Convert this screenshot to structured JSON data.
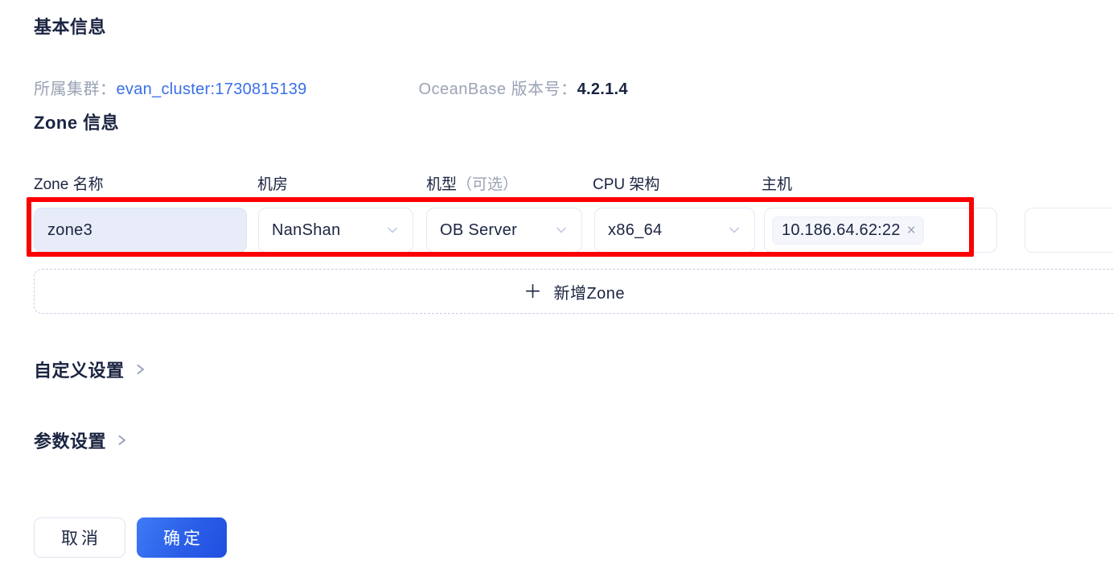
{
  "basic": {
    "title": "基本信息",
    "cluster_label": "所属集群：",
    "cluster_value": "evan_cluster:1730815139",
    "version_label": "OceanBase 版本号：",
    "version_value": "4.2.1.4"
  },
  "zone_section": {
    "title": "Zone 信息",
    "columns": [
      {
        "label": "Zone 名称",
        "optional": ""
      },
      {
        "label": "机房",
        "optional": ""
      },
      {
        "label": "机型",
        "optional": "（可选）"
      },
      {
        "label": "CPU 架构",
        "optional": ""
      },
      {
        "label": "主机",
        "optional": ""
      }
    ],
    "row": {
      "zone_name": "zone3",
      "idc": "NanShan",
      "model": "OB Server",
      "cpu_arch": "x86_64",
      "host_tag": "10.186.64.62:22",
      "host_tag_remove": "×"
    },
    "add_zone": {
      "plus": "＋",
      "label": "新增Zone"
    }
  },
  "collapsibles": [
    {
      "label": "自定义设置"
    },
    {
      "label": "参数设置"
    }
  ],
  "footer": {
    "cancel": "取消",
    "confirm": "确定"
  },
  "colors": {
    "accent_blue": "#3a6fe8",
    "confirm_gradient_from": "#3f7bf5",
    "confirm_gradient_to": "#1f4fe0",
    "annotation_red": "#fc0000",
    "disabled_field_bg": "#e7ecf8",
    "muted_text": "#9aa3b5",
    "text_primary": "#1b2441"
  }
}
